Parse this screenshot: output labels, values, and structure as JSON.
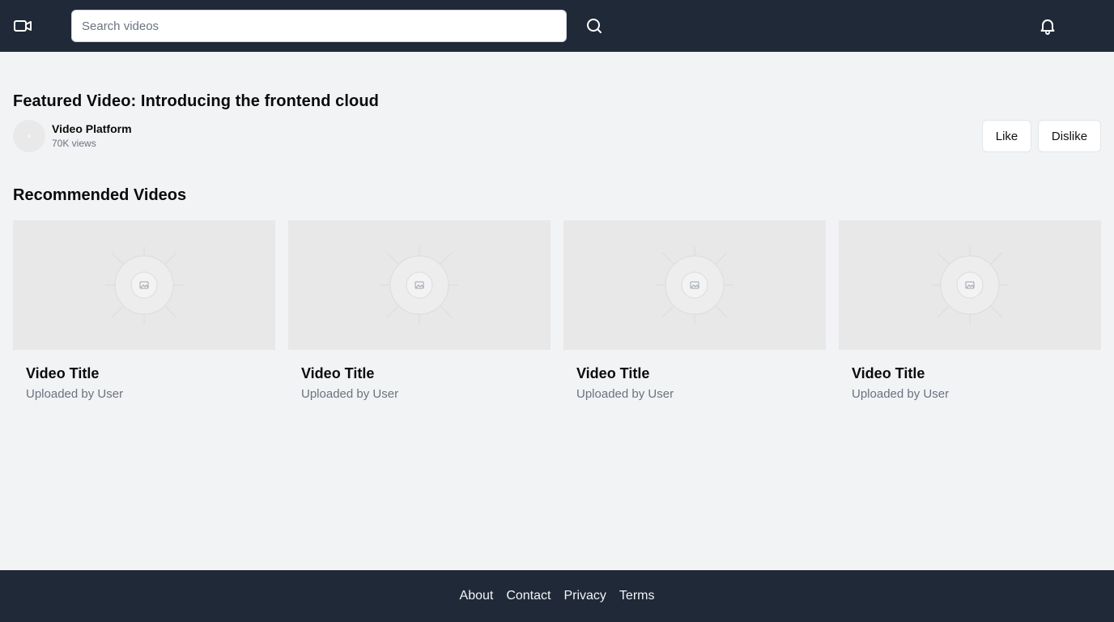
{
  "header": {
    "search_placeholder": "Search videos",
    "icons": {
      "logo": "video-camera-icon",
      "search": "search-icon",
      "notifications": "bell-icon"
    }
  },
  "featured": {
    "title": "Featured Video: Introducing the frontend cloud",
    "channel": "Video Platform",
    "views": "70K views",
    "like_label": "Like",
    "dislike_label": "Dislike"
  },
  "recommended": {
    "heading": "Recommended Videos",
    "videos": [
      {
        "title": "Video Title",
        "uploader": "Uploaded by User"
      },
      {
        "title": "Video Title",
        "uploader": "Uploaded by User"
      },
      {
        "title": "Video Title",
        "uploader": "Uploaded by User"
      },
      {
        "title": "Video Title",
        "uploader": "Uploaded by User"
      }
    ]
  },
  "footer": {
    "links": [
      "About",
      "Contact",
      "Privacy",
      "Terms"
    ]
  },
  "colors": {
    "header_bg": "#1f2937",
    "page_bg": "#f2f3f5",
    "thumbnail_bg": "#e8e8e8",
    "muted_text": "#6b7280"
  }
}
